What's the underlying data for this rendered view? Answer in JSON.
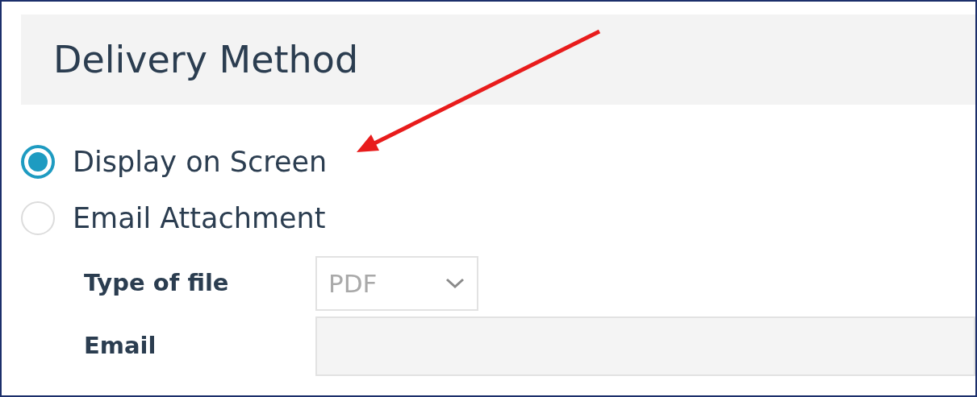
{
  "section": {
    "title": "Delivery Method"
  },
  "delivery_options": [
    {
      "label": "Display on Screen",
      "selected": true
    },
    {
      "label": "Email Attachment",
      "selected": false
    }
  ],
  "fields": [
    {
      "kind": "select",
      "label": "Type of file",
      "value": "PDF",
      "disabled": true
    },
    {
      "kind": "input",
      "label": "Email",
      "disabled": true
    }
  ]
}
